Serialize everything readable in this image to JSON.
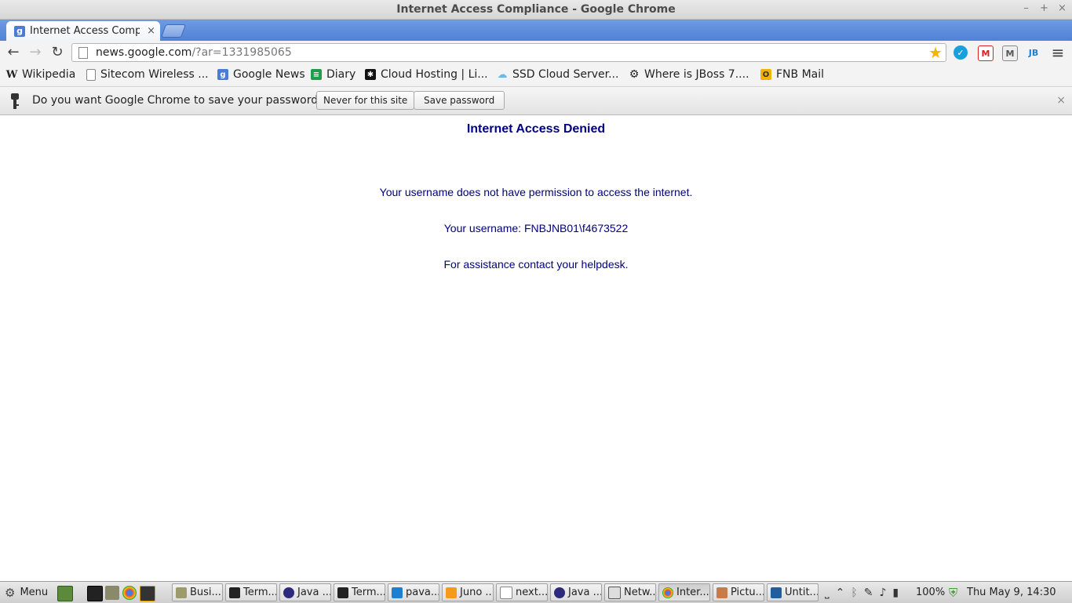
{
  "window": {
    "title": "Internet Access Compliance - Google Chrome",
    "controls": {
      "minimize": "–",
      "maximize": "+",
      "close": "×"
    }
  },
  "tabs": [
    {
      "title": "Internet Access Compli",
      "close": "×",
      "favicon": "g-news-icon"
    }
  ],
  "toolbar": {
    "back": "←",
    "forward": "→",
    "reload": "↻",
    "url_host": "news.google.com",
    "url_query": "/?ar=1331985065",
    "menu": "≡"
  },
  "bookmarks": [
    {
      "label": "Wikipedia",
      "icon": "W"
    },
    {
      "label": "Sitecom Wireless ...",
      "icon": "page"
    },
    {
      "label": "Google News",
      "icon": "g"
    },
    {
      "label": "Diary",
      "icon": "sheet"
    },
    {
      "label": "Cloud Hosting | Li...",
      "icon": "cloud-black"
    },
    {
      "label": "SSD Cloud Server...",
      "icon": "cloud"
    },
    {
      "label": "Where is JBoss 7....",
      "icon": "gear"
    },
    {
      "label": "FNB Mail",
      "icon": "O"
    }
  ],
  "infobar": {
    "message": "Do you want Google Chrome to save your password?",
    "never_button": "Never for this site",
    "save_button": "Save password",
    "close": "×"
  },
  "page": {
    "heading": "Internet Access Denied",
    "line1": "Your username does not have permission to access the internet.",
    "line2": "Your username: FNBJNB01\\f4673522",
    "line3": "For assistance contact your helpdesk."
  },
  "taskbar": {
    "menu_label": "Menu",
    "items": [
      {
        "label": "Busi..."
      },
      {
        "label": "Term..."
      },
      {
        "label": "Java ..."
      },
      {
        "label": "Term..."
      },
      {
        "label": "pava..."
      },
      {
        "label": "Juno ..."
      },
      {
        "label": "next..."
      },
      {
        "label": "Java ..."
      },
      {
        "label": "Netw..."
      },
      {
        "label": "Inter..."
      },
      {
        "label": "Pictu..."
      },
      {
        "label": "Untit..."
      }
    ],
    "battery": "100%",
    "clock": "Thu May  9, 14:30"
  },
  "colors": {
    "page_text": "#000080",
    "tabstrip": "#4f82d6"
  }
}
